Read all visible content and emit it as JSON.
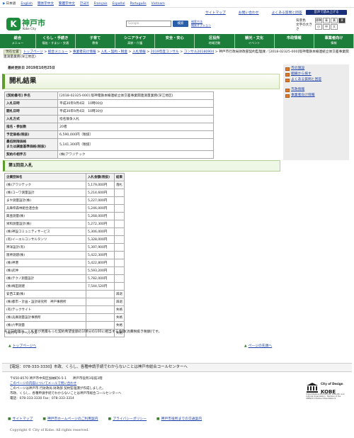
{
  "langbar": {
    "items": [
      "日本語",
      "English",
      "簡体字中文",
      "繁體字中文",
      "한국어",
      "Français",
      "Español",
      "Português",
      "Vietnam"
    ]
  },
  "header": {
    "logo_ja": "神戸市",
    "logo_en": "Kobe City",
    "logo_mark": "K",
    "top_links": [
      "サイトマップ",
      "お問い合わせ",
      "よくある質問と回答"
    ],
    "text_button": "音声で読み上げる",
    "search_placeholder": "Google",
    "search_button": "検索",
    "search_options": [
      "検索方法",
      "検索オプション"
    ],
    "bg_label": "背景色",
    "bg_options": [
      "標準",
      "青",
      "黄",
      "黒"
    ],
    "size_label": "文字の大きさ",
    "size_options": [
      "小",
      "中",
      "大"
    ]
  },
  "nav": [
    {
      "a": "総合",
      "b": "メニュー"
    },
    {
      "a": "くらし・手続き",
      "b": "福祉・すまい・交通"
    },
    {
      "a": "子育て",
      "b": "教育"
    },
    {
      "a": "シニアライフ",
      "b": "高齢・介護"
    },
    {
      "a": "安全・安心",
      "b": ""
    },
    {
      "a": "区役所",
      "b": "地域活動"
    },
    {
      "a": "観光・文化",
      "b": "イベント"
    },
    {
      "a": "市政情報",
      "b": ""
    },
    {
      "a": "事業者向け",
      "b": "情報"
    }
  ],
  "breadcrumb": {
    "here": "現在位置",
    "items": [
      "トップページ",
      "総合メニュー",
      "事業者向け情報",
      "入札・契約・税金",
      "入札情報",
      "2019年度コンサル",
      "コンサル20180904"
    ],
    "last": "神戸市行政局財政部契約監理課／[2018-02325-000]阪神電鉄本線連続立体交差事業関連測量業務(深江地区)"
  },
  "updated": "最終更新日 2019年10月25日",
  "page_title": "開札結果",
  "info_rows": [
    {
      "k": "[契約番号] 件名",
      "v": "[2018-02325-000] 阪神電鉄本線連続立体交差事業関連測量業務(深江地区)"
    },
    {
      "k": "入札日時",
      "v": "平成30年9月4日　10時00分"
    },
    {
      "k": "開札日時",
      "v": "平成30年9月4日　10時30分"
    },
    {
      "k": "入札方式",
      "v": "指名競争入札"
    },
    {
      "k": "指名・参加数",
      "v": "20者"
    },
    {
      "k": "予定価格(税抜)",
      "v": "6,590,000円（税抜）"
    },
    {
      "k": "最低制限価格\nまたは調査基準価格(税抜)",
      "v": "5,141,300円（税抜）"
    },
    {
      "k": "契約の相手方",
      "v": "(株)アワジテック"
    }
  ],
  "section_heading": "第1回目入札",
  "bid_header": [
    "企業団体名",
    "入札金額(税抜)",
    "結果"
  ],
  "bids": [
    {
      "name": "(株)アワジテック",
      "price": "5,179,000円",
      "result": "落札"
    },
    {
      "name": "(株)コーワ測量設計",
      "price": "5,214,600円",
      "result": ""
    },
    {
      "name": "まや測量設計(株)",
      "price": "5,227,000円",
      "result": ""
    },
    {
      "name": "兵庫県森林組合連合会",
      "price": "5,246,000円",
      "result": ""
    },
    {
      "name": "興亜測量(株)",
      "price": "5,268,000円",
      "result": ""
    },
    {
      "name": "栄和測量設計(株)",
      "price": "5,272,300円",
      "result": ""
    },
    {
      "name": "(株)神設コミュニティサービス",
      "price": "5,306,000円",
      "result": ""
    },
    {
      "name": "(有)イーエルコンサルタンツ",
      "price": "5,328,000円",
      "result": ""
    },
    {
      "name": "神洋設計(有)",
      "price": "5,397,900円",
      "result": ""
    },
    {
      "name": "阪神測建(株)",
      "price": "5,422,300円",
      "result": ""
    },
    {
      "name": "(株)神港",
      "price": "5,422,800円",
      "result": ""
    },
    {
      "name": "(株)武仲",
      "price": "5,593,200円",
      "result": ""
    },
    {
      "name": "(株)テクノ測量設計",
      "price": "5,782,000円",
      "result": ""
    },
    {
      "name": "(株)梅田測建",
      "price": "7,544,520円",
      "result": ""
    },
    {
      "name": "安西工業(株)",
      "price": "",
      "result": "辞退"
    },
    {
      "name": "(株)都市・計画・設計研究所　神戸事務所",
      "price": "",
      "result": "辞退"
    },
    {
      "name": "(有)テックサイト",
      "price": "",
      "result": "失格"
    },
    {
      "name": "(株)兵庫測量設計事務所",
      "price": "",
      "result": "失格"
    },
    {
      "name": "(株)六甲測量",
      "price": "",
      "result": "失格"
    },
    {
      "name": "(有)ディ・アベックス",
      "price": "",
      "result": "失格"
    }
  ],
  "note": "※上記金額は、入札者が見積もった契約希望金額の108分の100に相当する金額(消費税抜き税額)です。",
  "top_link": "トップページへ",
  "page_top_link": "ページの先頭へ",
  "sidebar": {
    "group1": [
      "市の施設",
      "組織から探す",
      "よくある質問と回答"
    ],
    "group2": [
      "市政情報",
      "事業者向け情報"
    ]
  },
  "footer": {
    "call": "【電話：078-333-3330】市政、くらし、各種申請手続でわからないことは神戸市総合コールセンターへ",
    "address_lines": [
      "〒650-8570 神戸市中央区加納町6-5-1　　神戸市役所3号館3階",
      "このページの内容についてメールで問い合わせ",
      "このページは神戸市 行財政局 財政部 契約監理課が作成しました。",
      "市政、くらし、各種申請手続でわからないことは神戸市総合コールセンターへ",
      "電話：078-333-3330 Fax：078-333-3314"
    ],
    "unesco_t1": "City of Design",
    "unesco_t2": "KOBE",
    "unesco_t3": "United Nations Educational, Scientific and Cultural Organization · Member of the UNESCO Creative Cities Network",
    "links": [
      "サイトマップ",
      "神戸市ホームページのご利用案内",
      "プライバシーポリシー",
      "神戸市役所までの交通案内"
    ],
    "copyright": "Copyright © City of Kobe. All rights reserved."
  },
  "colors": {
    "green": "#1d7d3a",
    "link": "#1a3fa8"
  }
}
